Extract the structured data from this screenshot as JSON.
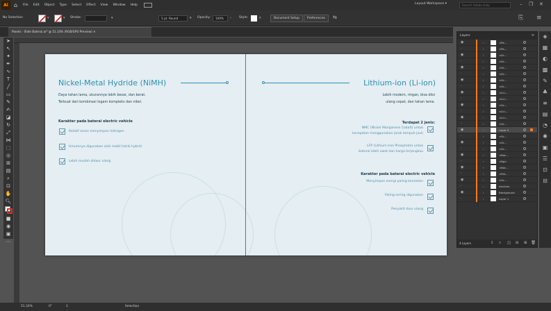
{
  "menubar": {
    "app_logo": "Ai",
    "home_icon": "home-icon",
    "items": [
      "File",
      "Edit",
      "Object",
      "Type",
      "Select",
      "Effect",
      "View",
      "Window",
      "Help"
    ],
    "workspace_switch": "Layout Workspace ▾",
    "help_search_placeholder": "Search Adobe Help"
  },
  "controlbar": {
    "selection_label": "No Selection",
    "stroke_label": "Stroke:",
    "brush_label": "5 pt. Round",
    "opacity_label": "Opacity:",
    "opacity_value": "100%",
    "style_label": "Style:",
    "doc_setup": "Document Setup",
    "preferences": "Preferences"
  },
  "document": {
    "tab_title": "Panels - Slide Baterai.ai* @ 51.33% (RGB/GPU Preview) ✕"
  },
  "left_page": {
    "title": "Nickel-Metal Hydride (NiMH)",
    "body_lines": [
      "Daya tahan lama, ukurannya lebih besar, dan berat.",
      "Terbuat dari kombinasi logam kompleks dan nikel."
    ],
    "heading": "Karakter pada baterai electric vehicle",
    "bullets": [
      "Relatif aman menyimpan hidrogen",
      "Umumnya digunakan oleh mobil listrik hybrid",
      "Lebih mudah didaur ulang"
    ]
  },
  "right_page": {
    "title": "Lithium-ion (Li-ion)",
    "body_lines": [
      "Lebih modern, ringan, bisa diisi",
      "ulang cepat, dan tahan lama."
    ],
    "subhead": "Terdapat 2 jenis:",
    "types": [
      [
        "NMC (Nickel Manganese Cobalt) untuk",
        "kecepatan menggunakan jarak tempuh jauh"
      ],
      [
        "LFP (Lithium Iron Phosphate) untuk",
        "baterai lebih awet dan harga terjangkau"
      ]
    ],
    "heading": "Karakter pada baterai electric vehicle",
    "bullets": [
      "Menyimpan energi paling konsisten",
      "Paling sering digunakan",
      "Penyakit daur ulang"
    ]
  },
  "layers_panel": {
    "title": "Layers",
    "rows": [
      {
        "name": "<Pa...",
        "selected": false
      },
      {
        "name": "<Pa...",
        "selected": false
      },
      {
        "name": "<Gr...",
        "selected": false
      },
      {
        "name": "<Gr...",
        "selected": false
      },
      {
        "name": "<Gr...",
        "selected": false
      },
      {
        "name": "<Gr...",
        "selected": false
      },
      {
        "name": "<Gr...",
        "selected": false
      },
      {
        "name": "<Gr...",
        "selected": false
      },
      {
        "name": "<Lin...",
        "selected": false
      },
      {
        "name": "<Lin...",
        "selected": false
      },
      {
        "name": "<Gr...",
        "selected": false
      },
      {
        "name": "<Lin...",
        "selected": false
      },
      {
        "name": "<Lin...",
        "selected": false
      },
      {
        "name": "<Gr...",
        "selected": false
      },
      {
        "name": "Layer 5",
        "selected": true
      },
      {
        "name": "<Gr...",
        "selected": false
      },
      {
        "name": "<Gr...",
        "selected": false
      },
      {
        "name": "<Gr...",
        "selected": false
      },
      {
        "name": "<Bac...",
        "selected": false
      },
      {
        "name": "<Bg>",
        "selected": false
      },
      {
        "name": "<Bac...",
        "selected": false
      },
      {
        "name": "<Pat...",
        "selected": false
      },
      {
        "name": "<Gr...",
        "selected": false
      },
      {
        "name": "Anchors",
        "selected": false
      },
      {
        "name": "Background",
        "selected": false
      },
      {
        "name": "Layer 1",
        "selected": false
      }
    ],
    "footer_label": "4 Layers"
  },
  "statusbar": {
    "zoom": "51.33%",
    "angle": "0°",
    "artboard": "1",
    "tool": "Selection"
  }
}
